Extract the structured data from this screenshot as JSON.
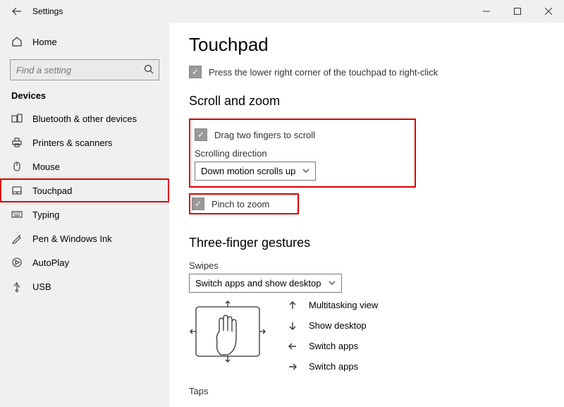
{
  "window": {
    "title": "Settings",
    "minimize": "–",
    "maximize": "□",
    "close": "×"
  },
  "sidebar": {
    "home": "Home",
    "search_placeholder": "Find a setting",
    "category": "Devices",
    "items": [
      {
        "label": "Bluetooth & other devices"
      },
      {
        "label": "Printers & scanners"
      },
      {
        "label": "Mouse"
      },
      {
        "label": "Touchpad"
      },
      {
        "label": "Typing"
      },
      {
        "label": "Pen & Windows Ink"
      },
      {
        "label": "AutoPlay"
      },
      {
        "label": "USB"
      }
    ]
  },
  "main": {
    "title": "Touchpad",
    "press_corner": "Press the lower right corner of the touchpad to right-click",
    "scroll_zoom_heading": "Scroll and zoom",
    "drag_two_fingers": "Drag two fingers to scroll",
    "scrolling_direction_label": "Scrolling direction",
    "scrolling_direction_value": "Down motion scrolls up",
    "pinch_to_zoom": "Pinch to zoom",
    "three_finger_heading": "Three-finger gestures",
    "swipes_label": "Swipes",
    "swipes_value": "Switch apps and show desktop",
    "gestures": {
      "up": "Multitasking view",
      "down": "Show desktop",
      "left": "Switch apps",
      "right": "Switch apps"
    },
    "taps_label": "Taps"
  }
}
